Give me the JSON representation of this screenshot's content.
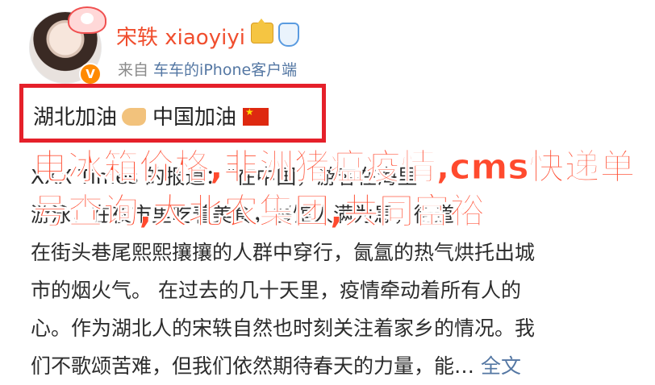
{
  "post": {
    "username": "宋轶 xiaoyiyi",
    "source_prefix": "来自 ",
    "source_device": "车车的iPhone客户端",
    "verified_badge": "V",
    "highlight_part1": "湖北加油",
    "highlight_part2": "中国加油",
    "overlay_text": "电冰箱价格,非洲猪瘟疫情,cms快递单号查询,大北农集团,共同富裕",
    "body_lines": [
      "XXX Times 的报道：“在中国，游客在海里",
      "游泳，在夜市里吃着美食，餐馆人满为患，街道",
      "在街头巷尾熙熙攘攘的人群中穿行，氤氲的热气烘托出城",
      "市的烟火气。  在过去的几十天里，疫情牵动着所有人的",
      "心。作为湖北人的宋轶自然也时刻关注着家乡的情况。我",
      "们不歌颂苦难，但我们依然期待春天的力量，能…"
    ],
    "more_label": "全文"
  },
  "icons": [
    "hat-icon",
    "verified-badge-icon",
    "crown-icon",
    "shield-icon",
    "muscle-icon",
    "china-flag-icon"
  ],
  "colors": {
    "username": "#f04e2e",
    "highlight_border": "#e5202a",
    "link": "#5477a3",
    "overlay": "#ff4a2e"
  }
}
